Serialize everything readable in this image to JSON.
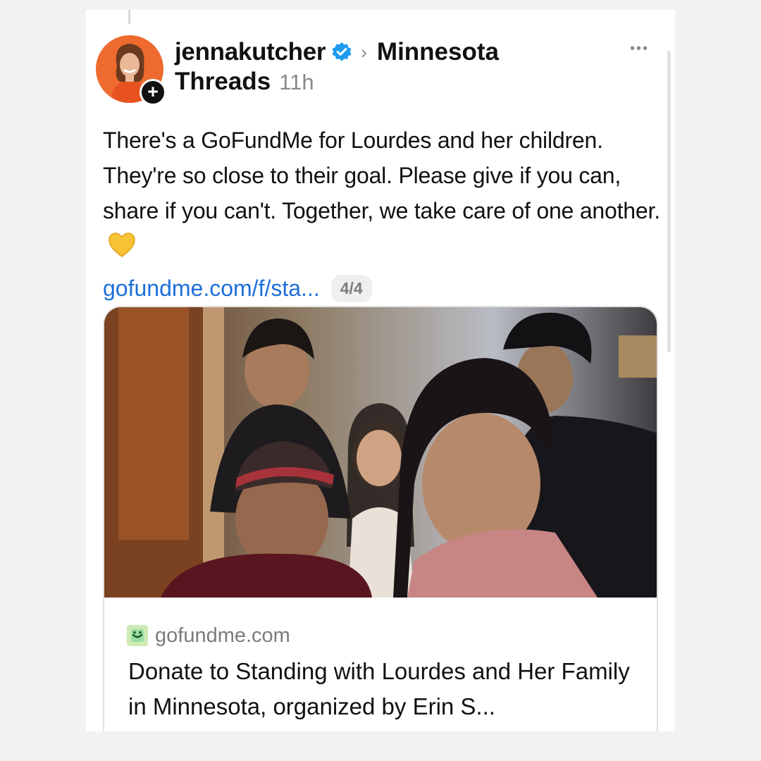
{
  "post": {
    "username": "jennakutcher",
    "separator": "›",
    "location": "Minnesota",
    "community": "Threads",
    "timestamp": "11h",
    "more_label": "•••",
    "follow_label": "+",
    "text": "There's a GoFundMe for Lourdes and her children. They're so close to their goal. Please give if you can, share if you can't. Together, we take care of one another.",
    "link_text": "gofundme.com/f/sta...",
    "media_count": "4/4"
  },
  "link_preview": {
    "site": "gofundme.com",
    "title": "Donate to Standing with Lourdes and Her Family in Minnesota, organized by Erin S..."
  },
  "icons": {
    "verified": "verified-check-icon",
    "follow": "plus-icon",
    "more": "ellipsis-icon",
    "heart": "yellow-heart-emoji",
    "favicon": "gofundme-logo-icon"
  },
  "colors": {
    "link": "#1d6fd8",
    "verified": "#1d9bf0",
    "heart": "#f7c233",
    "favicon_bg": "#00b964"
  }
}
